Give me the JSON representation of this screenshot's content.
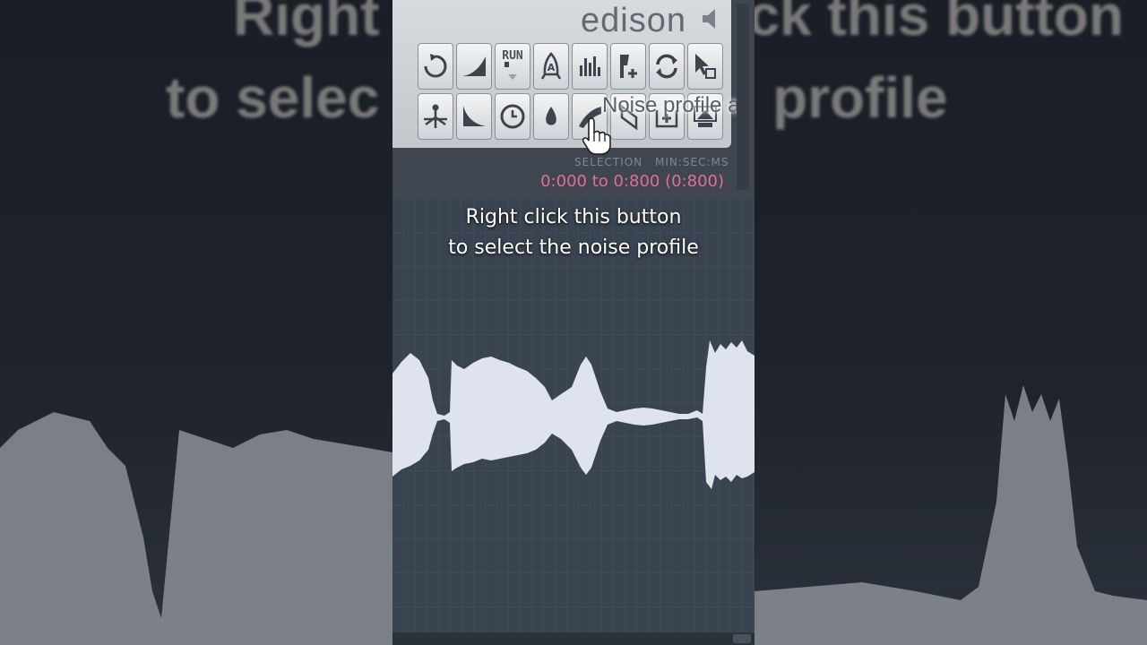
{
  "overlay_left": {
    "line1": "Right",
    "line2": "to selec"
  },
  "overlay_right": {
    "line1": "Right click this button",
    "line2": "profile"
  },
  "app": {
    "logo": "edison"
  },
  "toolbar": {
    "row1": [
      "loop-icon",
      "fade-in-icon",
      "run-icon",
      "rocket-icon",
      "spectrum-icon",
      "add-marker-icon",
      "refresh-icon",
      "select-cursor-icon"
    ],
    "row2": [
      "split-icon",
      "fade-out-icon",
      "clock-icon",
      "drop-icon",
      "noise-profile-icon",
      "bookmark-icon",
      "add-region-icon",
      "upload-icon"
    ],
    "run_label": "RUN"
  },
  "tooltip": "Noise profile a",
  "selection": {
    "label": "SELECTION",
    "units": "MIN:SEC:MS",
    "range": "0:000 to 0:800 (0:800)"
  },
  "caption": {
    "line1": "Right click this button",
    "line2": "to select the noise profile"
  },
  "colors": {
    "accent": "#e06f95",
    "waveform": "#dfe3ee",
    "editor_bg": "#3a4350"
  }
}
